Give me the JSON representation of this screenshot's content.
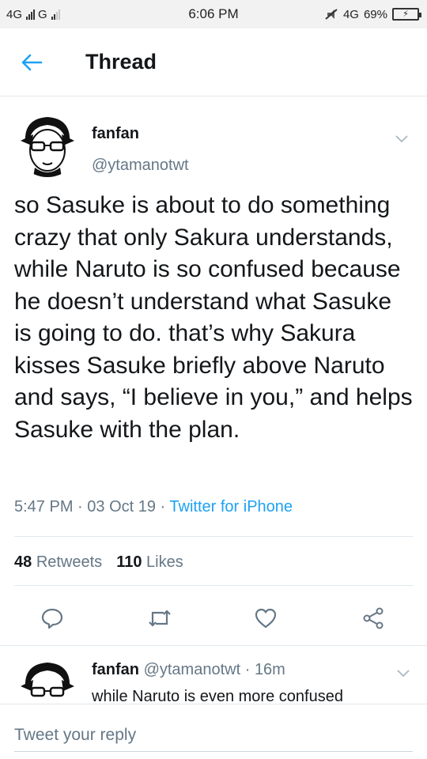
{
  "status_bar": {
    "left_text_1": "4G",
    "left_text_2": "G",
    "time": "6:06 PM",
    "network": "4G",
    "battery": "69%"
  },
  "header": {
    "title": "Thread"
  },
  "tweet": {
    "author_name": "fanfan",
    "author_handle": "@ytamanotwt",
    "text": "so Sasuke is about to do something crazy that only Sakura understands, while Naruto is so confused because he doesn’t understand what Sasuke is going to do. that’s why Sakura kisses Sasuke briefly above Naruto and says, “I believe in you,” and helps Sasuke with the plan.",
    "time": "5:47 PM",
    "date": "03 Oct 19",
    "source": "Twitter for iPhone",
    "retweets_count": "48",
    "retweets_label": "Retweets",
    "likes_count": "110",
    "likes_label": "Likes"
  },
  "reply": {
    "author_name": "fanfan",
    "author_handle": "@ytamanotwt",
    "age": "16m",
    "text": "while Naruto is even more confused"
  },
  "composer": {
    "placeholder": "Tweet your reply"
  },
  "colors": {
    "accent": "#1da1f2",
    "muted": "#657786",
    "text": "#14171a",
    "divider": "#e1e8ed"
  },
  "icons": [
    "back-arrow-icon",
    "chevron-down-icon",
    "reply-icon",
    "retweet-icon",
    "like-icon",
    "share-icon"
  ]
}
